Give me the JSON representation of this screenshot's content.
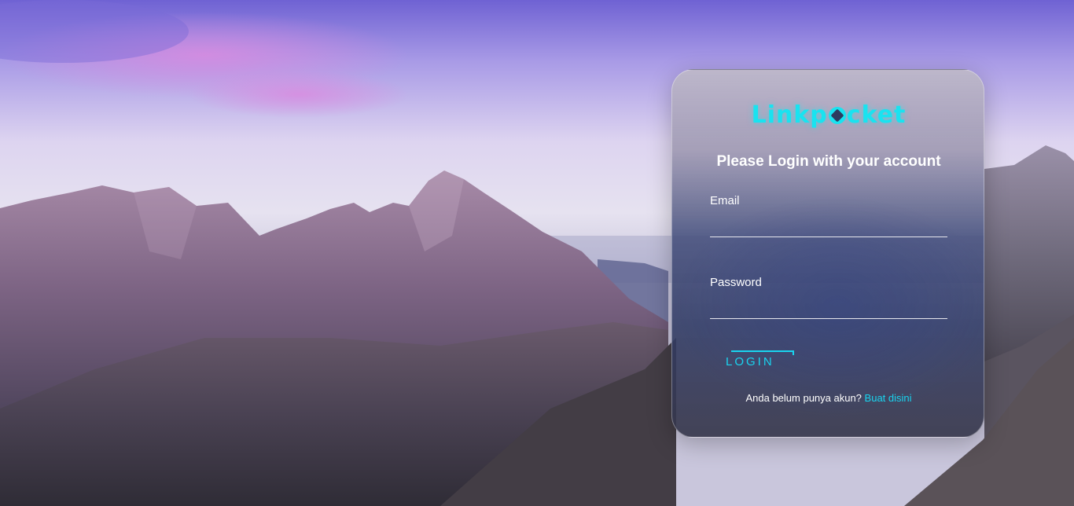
{
  "brand": {
    "name_start": "Linkp",
    "name_end": "cket",
    "color": "#19e3f0"
  },
  "form": {
    "title": "Please Login with your account",
    "email_label": "Email",
    "email_value": "",
    "password_label": "Password",
    "password_value": "",
    "login_label": "LOGIN"
  },
  "signup": {
    "prompt": "Anda belum punya akun?",
    "link_label": "Buat disini"
  },
  "colors": {
    "accent": "#19d4ef",
    "text": "#ffffff"
  }
}
